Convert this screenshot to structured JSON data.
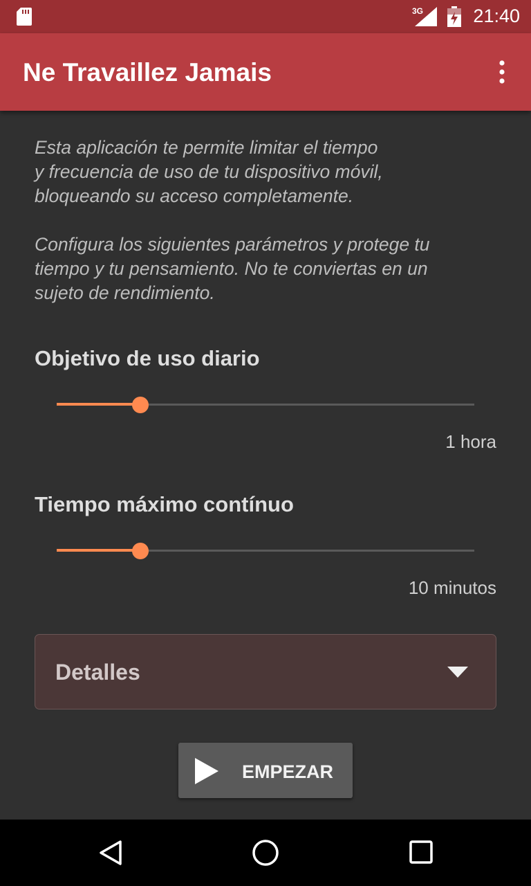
{
  "status_bar": {
    "time": "21:40",
    "network": "3G",
    "icons": [
      "sd-card-icon",
      "signal-icon",
      "battery-icon"
    ]
  },
  "app_bar": {
    "title": "Ne Travaillez Jamais",
    "menu_icon": "more-vert-icon"
  },
  "main": {
    "intro_text": "Esta aplicación te permite limitar el tiempo\ny frecuencia de uso de tu dispositivo móvil,\nbloqueando su acceso completamente.\n\nConfigura los siguientes parámetros y protege tu\ntiempo y tu pensamiento. No te conviertas en un\nsujeto de rendimiento.",
    "daily_goal": {
      "title": "Objetivo de uso diario",
      "value_label": "1 hora",
      "slider_fraction": 0.2
    },
    "max_continuous": {
      "title": "Tiempo máximo contínuo",
      "value_label": "10 minutos",
      "slider_fraction": 0.2
    },
    "details": {
      "label": "Detalles",
      "icon": "triangle-down-icon"
    },
    "start_button": {
      "label": "EMPEZAR",
      "icon": "play-icon"
    }
  },
  "nav_bar": {
    "icons": [
      "back-icon",
      "home-icon",
      "recents-icon"
    ]
  },
  "colors": {
    "status_bar": "#9a2f33",
    "app_bar": "#b83d42",
    "background": "#303030",
    "accent": "#ff8a50",
    "details_bg": "#4b3737"
  }
}
